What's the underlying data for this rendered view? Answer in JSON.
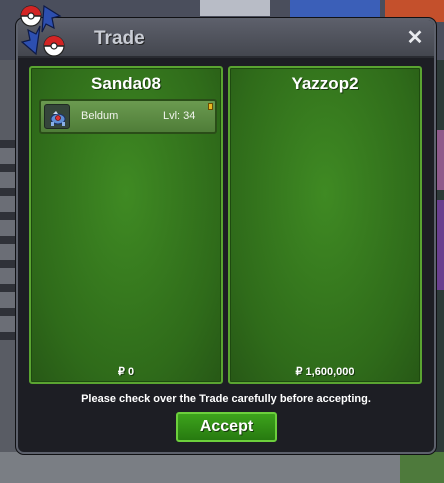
{
  "window": {
    "title": "Trade",
    "close_label": "✕"
  },
  "trade": {
    "left": {
      "player": "Sanda08",
      "items": [
        {
          "name": "Beldum",
          "level": "Lvl: 34",
          "icon": "beldum-pokemon-icon"
        }
      ],
      "money": "₽ 0"
    },
    "right": {
      "player": "Yazzop2",
      "items": [],
      "money": "₽ 1,600,000"
    },
    "notice": "Please check over the Trade carefully before accepting.",
    "accept_label": "Accept"
  },
  "colors": {
    "panel_green": "#2f6b1a",
    "panel_border": "#5aa431",
    "window_bg": "#1d1e24",
    "accept_green": "#3da31c"
  }
}
